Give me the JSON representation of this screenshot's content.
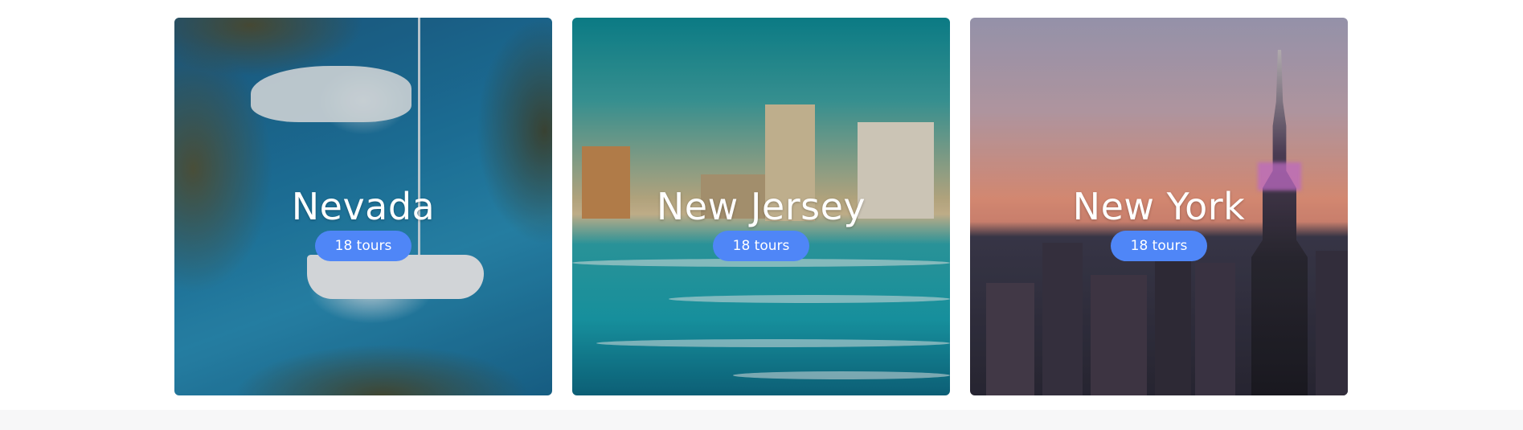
{
  "destinations": [
    {
      "name": "Nevada",
      "tours": "18 tours"
    },
    {
      "name": "New Jersey",
      "tours": "18 tours"
    },
    {
      "name": "New York",
      "tours": "18 tours"
    }
  ],
  "colors": {
    "badge": "#4f86f7",
    "title_text": "#ffffff"
  }
}
